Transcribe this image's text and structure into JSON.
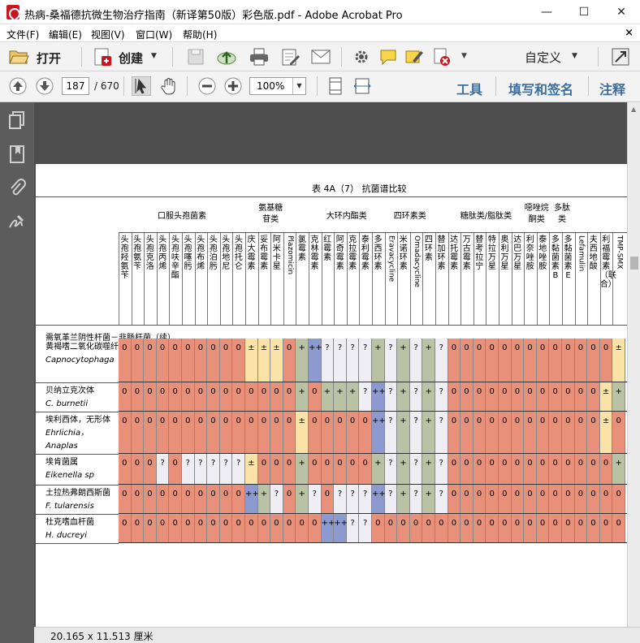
{
  "window": {
    "title": "热病-桑福德抗微生物治疗指南（新译第50版）彩色版.pdf - Adobe Acrobat Pro",
    "minimize": "—",
    "maximize": "☐",
    "close": "✕"
  },
  "menu": [
    "文件(F)",
    "编辑(E)",
    "视图(V)",
    "窗口(W)",
    "帮助(H)"
  ],
  "menu_close": "×",
  "toolbar": {
    "open_label": "打开",
    "create_label": "创建",
    "custom_label": "自定义"
  },
  "nav": {
    "page_value": "187",
    "page_count": "/ 670",
    "zoom_value": "100%",
    "tools_label": "工具",
    "fill_sign_label": "填写和签名",
    "comment_label": "注释"
  },
  "status": {
    "dimensions": "20.165 x 11.513 厘米"
  },
  "colors": {
    "red": "#e8907a",
    "yellow": "#fbe3a8",
    "blue": "#8c9ad0",
    "green": "#b9c2a4",
    "white": "#f3f3f3",
    "light": "#eeeef4"
  },
  "document": {
    "table_title": "表 4A（7）  抗菌谱比较",
    "groups": [
      "口服头孢菌素",
      "氨基糖",
      "苷类",
      "大环内酯类",
      "四环素类",
      "糖肽类/脂肽类",
      "噁唑烷",
      "酮类",
      "多肽",
      "类"
    ],
    "columns": [
      "头孢羟氨苄",
      "头孢氨苄",
      "头孢克洛",
      "头孢丙烯",
      "头孢呋辛酯",
      "头孢噻肟",
      "头孢布烯",
      "头孢泊肟",
      "头孢地尼",
      "头孢托仑",
      "庆大霉素",
      "妥布霉素",
      "阿米卡星",
      "Plazomicin",
      "氯霉素",
      "克林霉素",
      "红霉素",
      "阿奇霉素",
      "克拉霉素",
      "泰利霉素",
      "多西环素",
      "Eravacycline",
      "米诺环素",
      "Omadacycline",
      "四环素",
      "替加环素",
      "达托霉素",
      "万古霉素",
      "替考拉宁",
      "特拉万星",
      "奥利万星",
      "达巴万星",
      "利奈唑胺",
      "泰地唑胺",
      "多黏菌素B",
      "多黏菌素E",
      "Lefamulin",
      "夫西地酸",
      "利福霉素（联合）",
      "TMP-SMX"
    ],
    "section": "需氧革兰阴性杆菌－非肠杆菌（续）",
    "rows": [
      {
        "name_cn": "黄褐嗜二氧化碳噬纤维菌",
        "name_cn2": "",
        "name_latin": "Capnocytophaga",
        "name_latin2": "",
        "values": [
          "0",
          "0",
          "0",
          "0",
          "0",
          "0",
          "0",
          "0",
          "0",
          "0",
          "±",
          "±",
          "±",
          "0",
          "+",
          "++",
          "?",
          "?",
          "?",
          "?",
          "+",
          "?",
          "+",
          "?",
          "+",
          "?",
          "0",
          "0",
          "0",
          "0",
          "0",
          "0",
          "0",
          "0",
          "0",
          "0",
          "0",
          "0",
          "0",
          "±"
        ]
      },
      {
        "name_cn": "贝纳立克次体",
        "name_cn2": "",
        "name_latin": "C. burnetii",
        "name_latin2": "",
        "values": [
          "0",
          "0",
          "0",
          "0",
          "0",
          "0",
          "0",
          "0",
          "0",
          "0",
          "0",
          "0",
          "0",
          "0",
          "+",
          "0",
          "+",
          "+",
          "+",
          "?",
          "++",
          "?",
          "+",
          "?",
          "+",
          "?",
          "0",
          "0",
          "0",
          "0",
          "0",
          "0",
          "0",
          "0",
          "0",
          "0",
          "0",
          "0",
          "±",
          "+"
        ]
      },
      {
        "name_cn": "埃利西体，无形体",
        "name_cn2": "",
        "name_latin": "Ehrlichia，",
        "name_latin2": "Anaplas",
        "values": [
          "0",
          "0",
          "0",
          "0",
          "0",
          "0",
          "0",
          "0",
          "0",
          "0",
          "0",
          "0",
          "0",
          "0",
          "±",
          "0",
          "0",
          "0",
          "0",
          "0",
          "++",
          "?",
          "+",
          "?",
          "+",
          "?",
          "0",
          "0",
          "0",
          "0",
          "0",
          "0",
          "0",
          "0",
          "0",
          "0",
          "0",
          "0",
          "±",
          "0"
        ]
      },
      {
        "name_cn": "埃肯菌属",
        "name_cn2": "",
        "name_latin": "Eikenella sp",
        "name_latin2": "",
        "values": [
          "0",
          "0",
          "0",
          "?",
          "0",
          "?",
          "?",
          "?",
          "?",
          "?",
          "±",
          "0",
          "0",
          "0",
          "+",
          "0",
          "0",
          "0",
          "0",
          "0",
          "+",
          "?",
          "+",
          "?",
          "+",
          "?",
          "0",
          "0",
          "0",
          "0",
          "0",
          "0",
          "0",
          "0",
          "0",
          "0",
          "0",
          "0",
          "0",
          "+"
        ]
      },
      {
        "name_cn": "土拉热弗朗西斯菌",
        "name_cn2": "",
        "name_latin": "F. tularensis",
        "name_latin2": "",
        "values": [
          "0",
          "0",
          "0",
          "0",
          "0",
          "0",
          "0",
          "0",
          "0",
          "0",
          "++",
          "+",
          "?",
          "0",
          "+",
          "?",
          "0",
          "?",
          "?",
          "?",
          "++",
          "?",
          "+",
          "?",
          "+",
          "?",
          "0",
          "0",
          "0",
          "0",
          "0",
          "0",
          "0",
          "0",
          "0",
          "0",
          "0",
          "0",
          "0",
          "0"
        ]
      },
      {
        "name_cn": "杜克嗜血杆菌",
        "name_cn2": "",
        "name_latin": "H. ducreyi",
        "name_latin2": "",
        "values": [
          "0",
          "0",
          "0",
          "0",
          "0",
          "0",
          "0",
          "0",
          "0",
          "0",
          "0",
          "0",
          "0",
          "0",
          "0",
          "0",
          "++",
          "++",
          "?",
          "?",
          "0",
          "0",
          "0",
          "0",
          "0",
          "0",
          "0",
          "0",
          "0",
          "0",
          "0",
          "0",
          "0",
          "0",
          "0",
          "0",
          "0",
          "0",
          "0",
          "0"
        ]
      }
    ]
  }
}
